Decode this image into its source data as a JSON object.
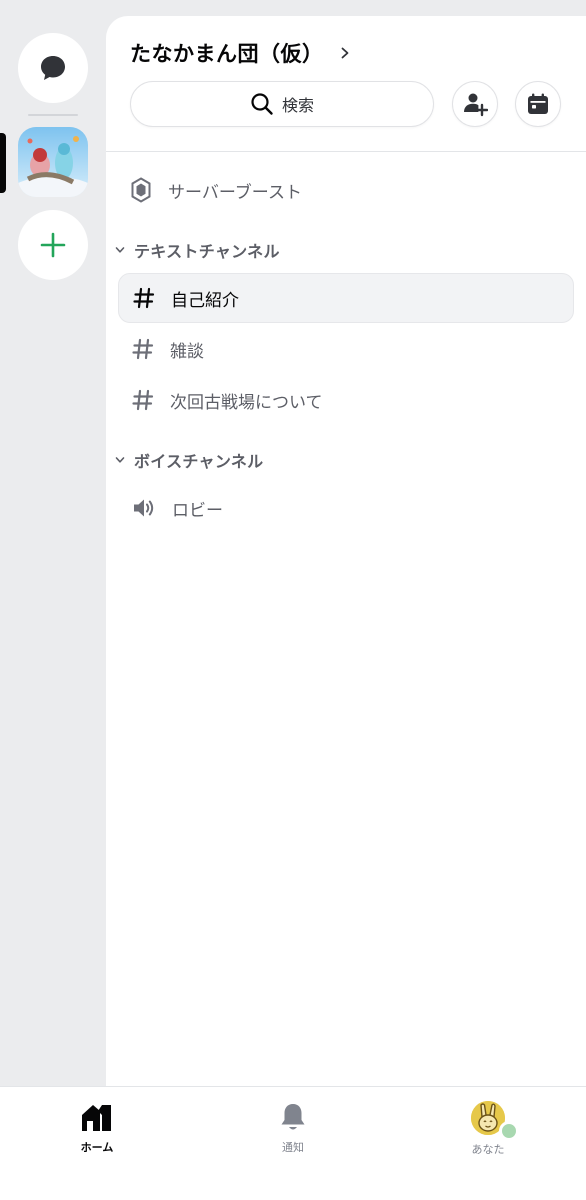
{
  "server": {
    "name": "たなかまん団（仮）",
    "search_label": "検索"
  },
  "boost": {
    "label": "サーバーブースト"
  },
  "categories": {
    "text": "テキストチャンネル",
    "voice": "ボイスチャンネル"
  },
  "text_channels": [
    {
      "name": "自己紹介",
      "selected": true
    },
    {
      "name": "雑談",
      "selected": false
    },
    {
      "name": "次回古戦場について",
      "selected": false
    }
  ],
  "voice_channels": [
    {
      "name": "ロビー"
    }
  ],
  "bottom_nav": {
    "home": "ホーム",
    "notifications": "通知",
    "you": "あなた"
  },
  "colors": {
    "accent_add": "#23a55a",
    "rail_bg": "#ebecee",
    "selected_channel_bg": "#f2f3f5",
    "status_dot": "#a8d8b0"
  },
  "icons": {
    "dm": "chat-bubble-icon",
    "add_server": "plus-icon",
    "search": "search-icon",
    "invite": "add-user-icon",
    "events": "calendar-icon",
    "boost": "boost-gem-icon",
    "text_channel": "hash-icon",
    "voice_channel": "speaker-icon",
    "home": "home-icon",
    "notifications": "bell-icon"
  }
}
